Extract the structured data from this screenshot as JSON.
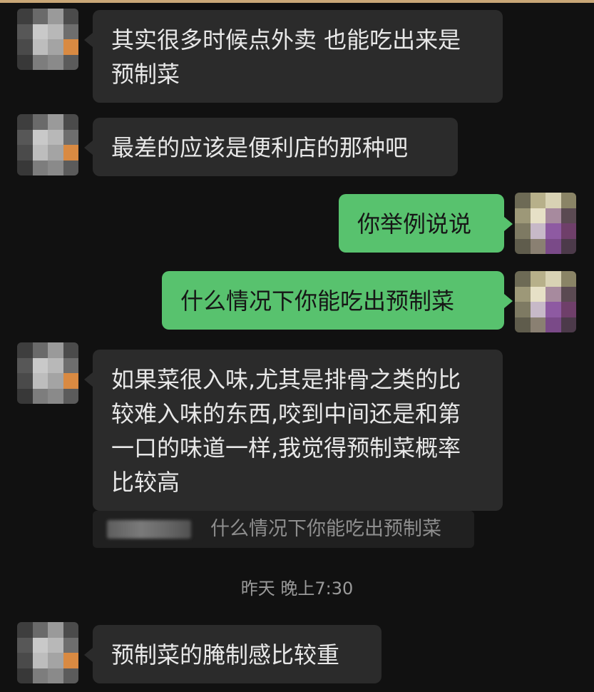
{
  "conversation": {
    "messages": [
      {
        "id": "m1",
        "side": "left",
        "text": "其实很多时候点外卖 也能吃出来是预制菜"
      },
      {
        "id": "m2",
        "side": "left",
        "text": "最差的应该是便利店的那种吧"
      },
      {
        "id": "m3",
        "side": "right",
        "text": "你举例说说"
      },
      {
        "id": "m4",
        "side": "right",
        "text": "什么情况下你能吃出预制菜"
      },
      {
        "id": "m5",
        "side": "left",
        "text": "如果菜很入味,尤其是排骨之类的比较难入味的东西,咬到中间还是和第一口的味道一样,我觉得预制菜概率比较高"
      },
      {
        "id": "m6",
        "side": "left",
        "text": "预制菜的腌制感比较重"
      }
    ],
    "quote": {
      "text": "什么情况下你能吃出预制菜"
    },
    "timestamp": "昨天 晚上7:30"
  },
  "colors": {
    "background": "#111111",
    "left_bubble": "#2b2b2b",
    "right_bubble": "#58c26e",
    "left_text": "#e8e8e8",
    "right_text": "#161616",
    "muted_text": "#9a9a9a"
  }
}
